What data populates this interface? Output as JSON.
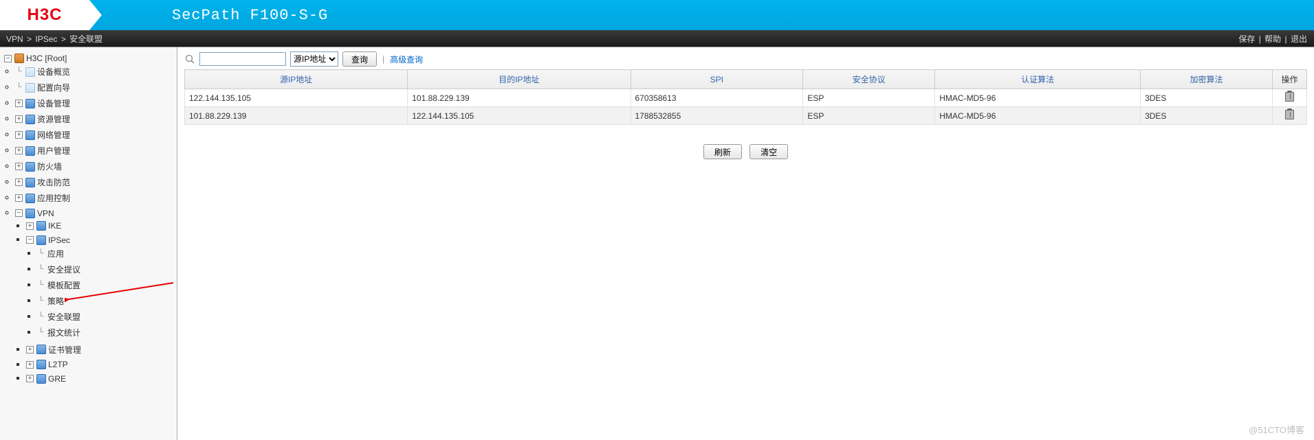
{
  "header": {
    "logo_text": "H3C",
    "title": "SecPath F100-S-G"
  },
  "breadcrumb": {
    "items": [
      "VPN",
      "IPSec",
      "安全联盟"
    ],
    "sep": ">",
    "links": {
      "save": "保存",
      "help": "帮助",
      "logout": "退出"
    }
  },
  "tree": {
    "root": "H3C [Root]",
    "items": [
      {
        "label": "设备概览",
        "type": "doc"
      },
      {
        "label": "配置向导",
        "type": "doc"
      },
      {
        "label": "设备管理",
        "type": "folder"
      },
      {
        "label": "资源管理",
        "type": "folder"
      },
      {
        "label": "网络管理",
        "type": "folder"
      },
      {
        "label": "用户管理",
        "type": "folder"
      },
      {
        "label": "防火墙",
        "type": "folder"
      },
      {
        "label": "攻击防范",
        "type": "folder"
      },
      {
        "label": "应用控制",
        "type": "folder"
      }
    ],
    "vpn": {
      "label": "VPN",
      "ike": "IKE",
      "ipsec": {
        "label": "IPSec",
        "children": [
          {
            "label": "应用"
          },
          {
            "label": "安全提议"
          },
          {
            "label": "模板配置"
          },
          {
            "label": "策略"
          },
          {
            "label": "安全联盟"
          },
          {
            "label": "报文统计"
          }
        ]
      },
      "cert": "证书管理",
      "l2tp": "L2TP",
      "gre": "GRE"
    }
  },
  "search": {
    "value": "",
    "select": "源IP地址",
    "button": "查询",
    "advanced": "高级查询"
  },
  "table": {
    "headers": {
      "src": "源IP地址",
      "dst": "目的IP地址",
      "spi": "SPI",
      "proto": "安全协议",
      "auth": "认证算法",
      "enc": "加密算法",
      "op": "操作"
    },
    "rows": [
      {
        "src": "122.144.135.105",
        "dst": "101.88.229.139",
        "spi": "670358613",
        "proto": "ESP",
        "auth": "HMAC-MD5-96",
        "enc": "3DES"
      },
      {
        "src": "101.88.229.139",
        "dst": "122.144.135.105",
        "spi": "1788532855",
        "proto": "ESP",
        "auth": "HMAC-MD5-96",
        "enc": "3DES"
      }
    ]
  },
  "actions": {
    "refresh": "刷新",
    "clear": "清空"
  },
  "watermark": "@51CTO博客"
}
